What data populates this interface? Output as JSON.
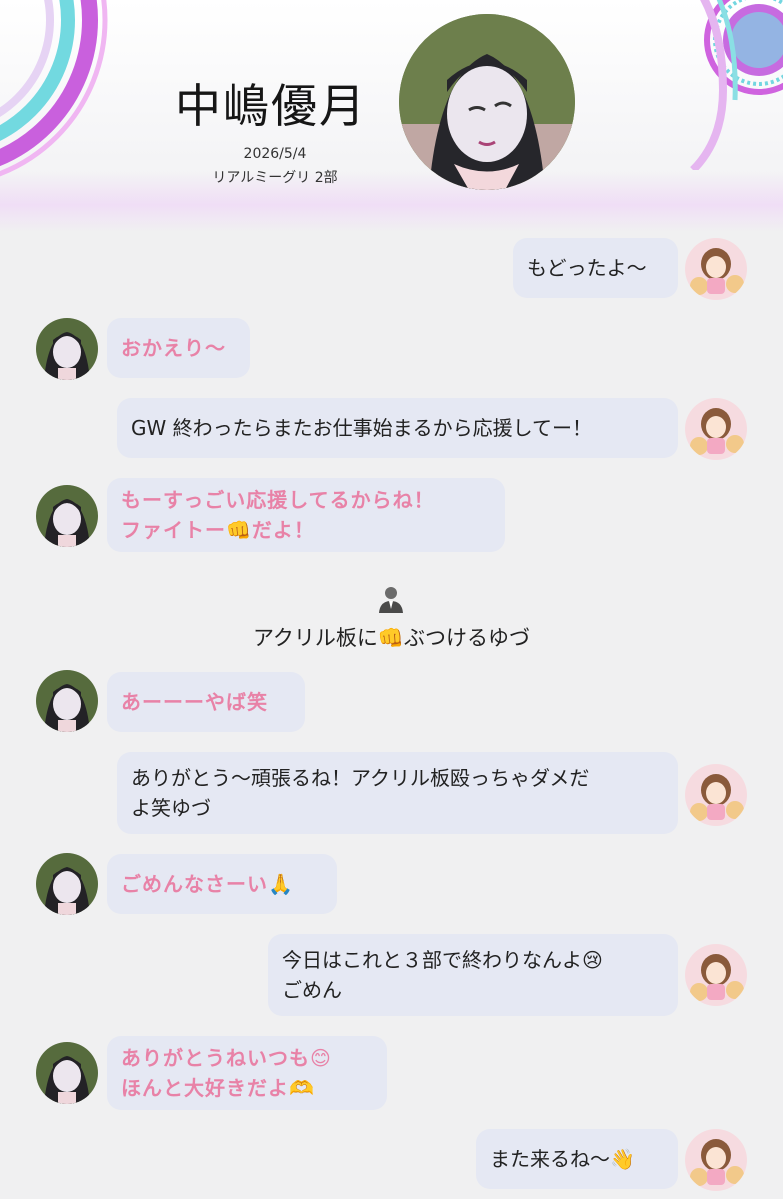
{
  "header": {
    "name": "中嶋優月",
    "date": "2026/5/4",
    "event": "リアルミーグリ 2部"
  },
  "messages": [
    {
      "from": "me",
      "text": "もどったよ〜"
    },
    {
      "from": "her",
      "text": "おかえり〜"
    },
    {
      "from": "me",
      "text": "GW 終わったらまたお仕事始まるから応援してー！"
    },
    {
      "from": "her",
      "text": "もーすっごい応援してるからね！\nファイトー👊だよ！"
    },
    {
      "from": "staff",
      "text": "アクリル板に👊ぶつけるゆづ"
    },
    {
      "from": "her",
      "text": "あーーーやば笑"
    },
    {
      "from": "me",
      "text": "ありがとう〜頑張るね！アクリル板殴っちゃダメだ\nよ笑ゆづ"
    },
    {
      "from": "her",
      "text": "ごめんなさーい🙏"
    },
    {
      "from": "me",
      "text": "今日はこれと３部で終わりなんよ😢\nごめん"
    },
    {
      "from": "her",
      "text": "ありがとうねいつも😊\nほんと大好きだよ🫶"
    },
    {
      "from": "me",
      "text": "また来るね〜👋"
    }
  ],
  "colors": {
    "background": "#f0f0f1",
    "bubble": "#e5e8f3",
    "her_text": "#e882a7",
    "me_text": "#222222",
    "accent_pink": "#d86be0",
    "accent_cyan": "#6fdde0"
  },
  "icons": {
    "staff": "person-suit-icon",
    "her_avatar": "idol-photo-avatar",
    "my_avatar": "anime-girl-avatar"
  }
}
